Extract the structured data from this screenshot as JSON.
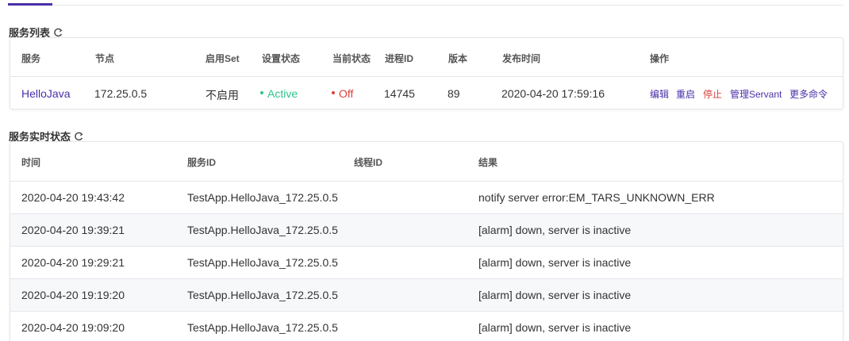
{
  "section1": {
    "title": "服务列表",
    "columns": [
      "服务",
      "节点",
      "启用Set",
      "设置状态",
      "当前状态",
      "进程ID",
      "版本",
      "发布时间",
      "操作"
    ],
    "row": {
      "service": "HelloJava",
      "node": "172.25.0.5",
      "set_enabled": "不启用",
      "setting_status": "Active",
      "current_status": "Off",
      "pid": "14745",
      "version": "89",
      "publish_time": "2020-04-20 17:59:16",
      "actions": [
        "编辑",
        "重启",
        "停止",
        "管理Servant",
        "更多命令"
      ]
    }
  },
  "section2": {
    "title": "服务实时状态",
    "columns": [
      "时间",
      "服务ID",
      "线程ID",
      "结果"
    ],
    "rows": [
      {
        "time": "2020-04-20 19:43:42",
        "service_id": "TestApp.HelloJava_172.25.0.5",
        "thread_id": "",
        "result": "notify server error:EM_TARS_UNKNOWN_ERR"
      },
      {
        "time": "2020-04-20 19:39:21",
        "service_id": "TestApp.HelloJava_172.25.0.5",
        "thread_id": "",
        "result": "[alarm] down, server is inactive"
      },
      {
        "time": "2020-04-20 19:29:21",
        "service_id": "TestApp.HelloJava_172.25.0.5",
        "thread_id": "",
        "result": "[alarm] down, server is inactive"
      },
      {
        "time": "2020-04-20 19:19:20",
        "service_id": "TestApp.HelloJava_172.25.0.5",
        "thread_id": "",
        "result": "[alarm] down, server is inactive"
      },
      {
        "time": "2020-04-20 19:09:20",
        "service_id": "TestApp.HelloJava_172.25.0.5",
        "thread_id": "",
        "result": "[alarm] down, server is inactive"
      }
    ]
  },
  "colors": {
    "accent": "#4a2fa8",
    "active_green": "#2cc48a",
    "off_red": "#d9413b"
  },
  "icons": [
    "refresh-icon"
  ]
}
